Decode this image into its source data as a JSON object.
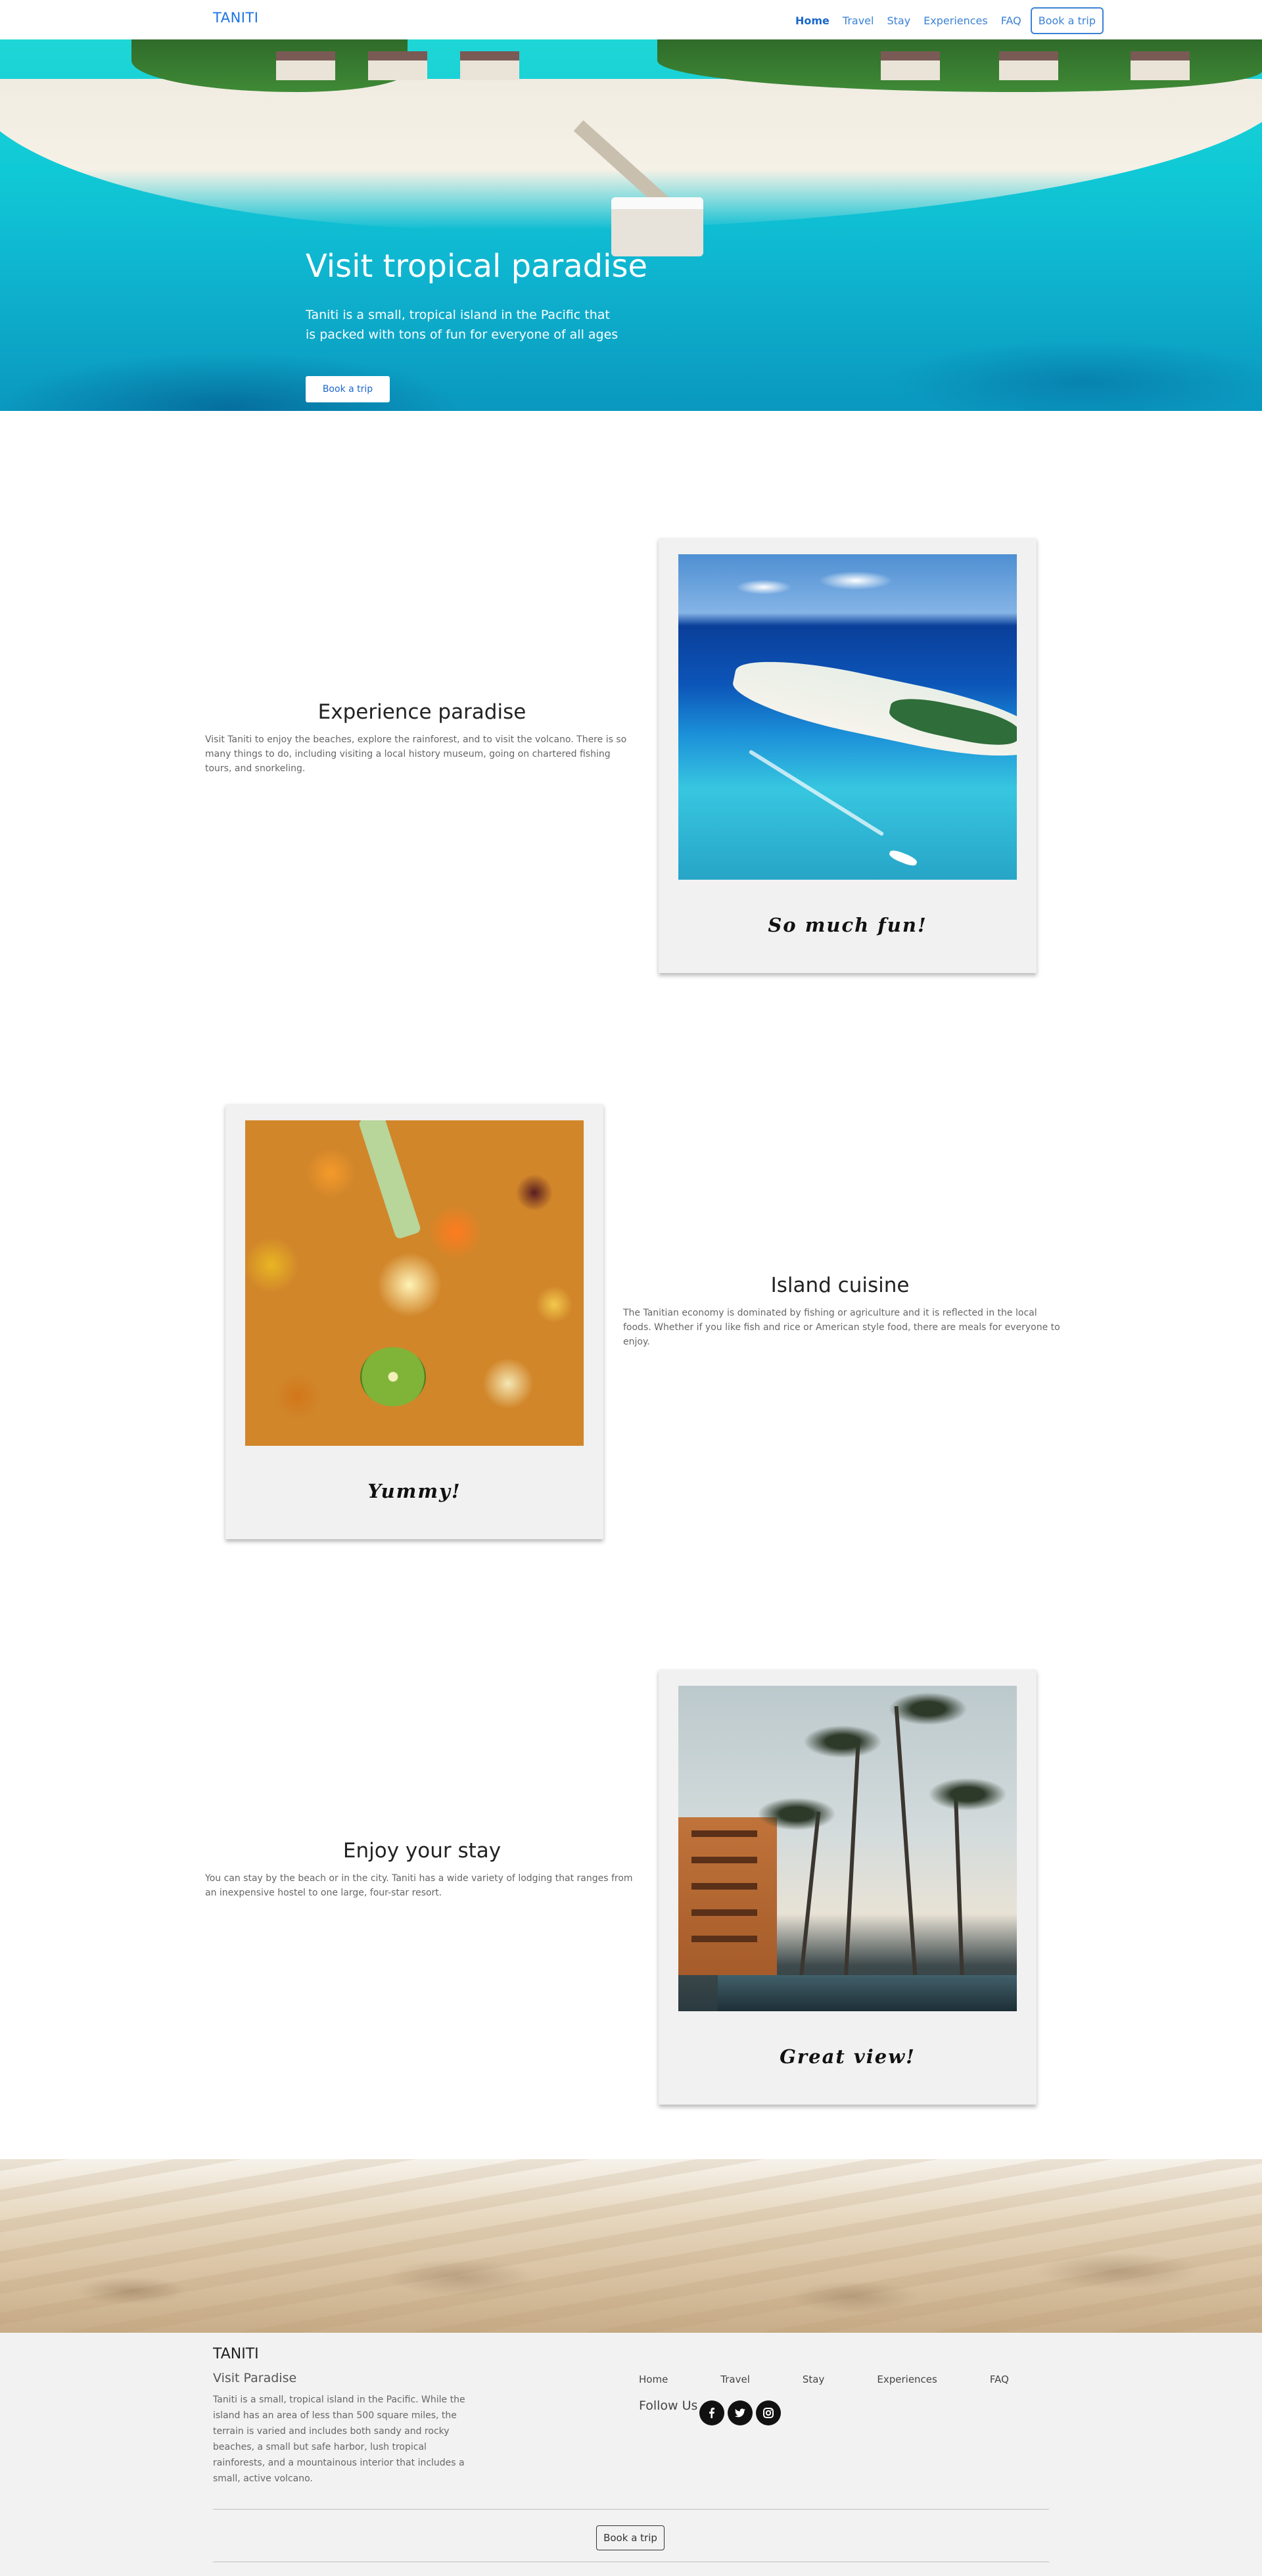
{
  "nav": {
    "brand": "TANITI",
    "links": [
      {
        "label": "Home",
        "active": true
      },
      {
        "label": "Travel"
      },
      {
        "label": "Stay"
      },
      {
        "label": "Experiences"
      },
      {
        "label": "FAQ"
      }
    ],
    "cta": "Book a trip"
  },
  "hero": {
    "title": "Visit tropical paradise",
    "subtitle": "Taniti is a small, tropical island in the Pacific that is packed with tons of fun for everyone of all ages",
    "button": "Book a trip"
  },
  "sections": [
    {
      "title": "Experience paradise",
      "text": "Visit Taniti to enjoy the beaches, explore the rainforest, and to visit the volcano. There is so many things to do, including visiting a local history museum, going on chartered fishing tours, and snorkeling.",
      "caption": "So much fun!",
      "image": "aerial-island-ocean-photo"
    },
    {
      "title": "Island cuisine",
      "text": "The Tanitian economy is dominated by fishing or agriculture and it is reflected in the local foods. Whether if you like fish and rice or American style food, there are meals for everyone to enjoy.",
      "caption": "Yummy!",
      "image": "dried-fruit-photo"
    },
    {
      "title": "Enjoy your stay",
      "text": "You can stay by the beach or in the city. Taniti has a wide variety of lodging that ranges from an inexpensive hostel to one large, four-star resort.",
      "caption": "Great view!",
      "image": "palm-trees-resort-photo"
    }
  ],
  "footer": {
    "brand": "TANITI",
    "subtitle": "Visit Paradise",
    "text": "Taniti is a small, tropical island in the Pacific. While the island has an area of less than 500 square miles, the terrain is varied and includes both sandy and rocky beaches, a small but safe harbor, lush tropical rainforests, and a mountainous interior that includes a small, active volcano.",
    "links": [
      "Home",
      "Travel",
      "Stay",
      "Experiences",
      "FAQ"
    ],
    "follow": "Follow Us",
    "social": [
      "facebook-icon",
      "twitter-icon",
      "instagram-icon"
    ],
    "button": "Book a trip"
  },
  "colors": {
    "accent": "#3b82d6",
    "footer_bg": "#f2f2f2",
    "card_bg": "#f1f1f1"
  }
}
